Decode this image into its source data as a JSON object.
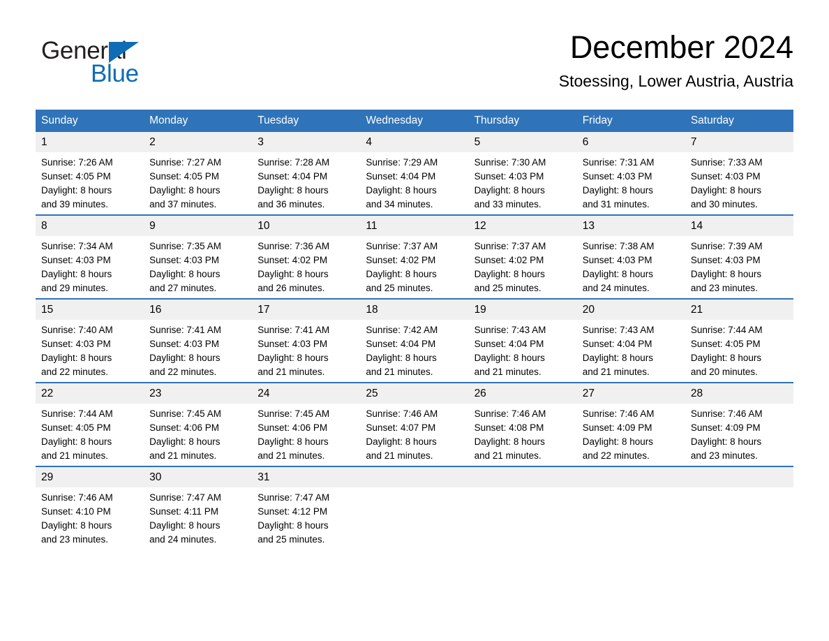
{
  "brand": {
    "name_part1": "General",
    "name_part2": "Blue",
    "triangle_color": "#0f6cb5"
  },
  "header": {
    "title": "December 2024",
    "location": "Stoessing, Lower Austria, Austria"
  },
  "theme": {
    "header_blue": "#2f73b8",
    "daynum_gray": "#f0f0f0",
    "text_black": "#000000"
  },
  "columns": [
    "Sunday",
    "Monday",
    "Tuesday",
    "Wednesday",
    "Thursday",
    "Friday",
    "Saturday"
  ],
  "weeks": [
    [
      {
        "day": "1",
        "sunrise": "Sunrise: 7:26 AM",
        "sunset": "Sunset: 4:05 PM",
        "daylight1": "Daylight: 8 hours",
        "daylight2": "and 39 minutes."
      },
      {
        "day": "2",
        "sunrise": "Sunrise: 7:27 AM",
        "sunset": "Sunset: 4:05 PM",
        "daylight1": "Daylight: 8 hours",
        "daylight2": "and 37 minutes."
      },
      {
        "day": "3",
        "sunrise": "Sunrise: 7:28 AM",
        "sunset": "Sunset: 4:04 PM",
        "daylight1": "Daylight: 8 hours",
        "daylight2": "and 36 minutes."
      },
      {
        "day": "4",
        "sunrise": "Sunrise: 7:29 AM",
        "sunset": "Sunset: 4:04 PM",
        "daylight1": "Daylight: 8 hours",
        "daylight2": "and 34 minutes."
      },
      {
        "day": "5",
        "sunrise": "Sunrise: 7:30 AM",
        "sunset": "Sunset: 4:03 PM",
        "daylight1": "Daylight: 8 hours",
        "daylight2": "and 33 minutes."
      },
      {
        "day": "6",
        "sunrise": "Sunrise: 7:31 AM",
        "sunset": "Sunset: 4:03 PM",
        "daylight1": "Daylight: 8 hours",
        "daylight2": "and 31 minutes."
      },
      {
        "day": "7",
        "sunrise": "Sunrise: 7:33 AM",
        "sunset": "Sunset: 4:03 PM",
        "daylight1": "Daylight: 8 hours",
        "daylight2": "and 30 minutes."
      }
    ],
    [
      {
        "day": "8",
        "sunrise": "Sunrise: 7:34 AM",
        "sunset": "Sunset: 4:03 PM",
        "daylight1": "Daylight: 8 hours",
        "daylight2": "and 29 minutes."
      },
      {
        "day": "9",
        "sunrise": "Sunrise: 7:35 AM",
        "sunset": "Sunset: 4:03 PM",
        "daylight1": "Daylight: 8 hours",
        "daylight2": "and 27 minutes."
      },
      {
        "day": "10",
        "sunrise": "Sunrise: 7:36 AM",
        "sunset": "Sunset: 4:02 PM",
        "daylight1": "Daylight: 8 hours",
        "daylight2": "and 26 minutes."
      },
      {
        "day": "11",
        "sunrise": "Sunrise: 7:37 AM",
        "sunset": "Sunset: 4:02 PM",
        "daylight1": "Daylight: 8 hours",
        "daylight2": "and 25 minutes."
      },
      {
        "day": "12",
        "sunrise": "Sunrise: 7:37 AM",
        "sunset": "Sunset: 4:02 PM",
        "daylight1": "Daylight: 8 hours",
        "daylight2": "and 25 minutes."
      },
      {
        "day": "13",
        "sunrise": "Sunrise: 7:38 AM",
        "sunset": "Sunset: 4:03 PM",
        "daylight1": "Daylight: 8 hours",
        "daylight2": "and 24 minutes."
      },
      {
        "day": "14",
        "sunrise": "Sunrise: 7:39 AM",
        "sunset": "Sunset: 4:03 PM",
        "daylight1": "Daylight: 8 hours",
        "daylight2": "and 23 minutes."
      }
    ],
    [
      {
        "day": "15",
        "sunrise": "Sunrise: 7:40 AM",
        "sunset": "Sunset: 4:03 PM",
        "daylight1": "Daylight: 8 hours",
        "daylight2": "and 22 minutes."
      },
      {
        "day": "16",
        "sunrise": "Sunrise: 7:41 AM",
        "sunset": "Sunset: 4:03 PM",
        "daylight1": "Daylight: 8 hours",
        "daylight2": "and 22 minutes."
      },
      {
        "day": "17",
        "sunrise": "Sunrise: 7:41 AM",
        "sunset": "Sunset: 4:03 PM",
        "daylight1": "Daylight: 8 hours",
        "daylight2": "and 21 minutes."
      },
      {
        "day": "18",
        "sunrise": "Sunrise: 7:42 AM",
        "sunset": "Sunset: 4:04 PM",
        "daylight1": "Daylight: 8 hours",
        "daylight2": "and 21 minutes."
      },
      {
        "day": "19",
        "sunrise": "Sunrise: 7:43 AM",
        "sunset": "Sunset: 4:04 PM",
        "daylight1": "Daylight: 8 hours",
        "daylight2": "and 21 minutes."
      },
      {
        "day": "20",
        "sunrise": "Sunrise: 7:43 AM",
        "sunset": "Sunset: 4:04 PM",
        "daylight1": "Daylight: 8 hours",
        "daylight2": "and 21 minutes."
      },
      {
        "day": "21",
        "sunrise": "Sunrise: 7:44 AM",
        "sunset": "Sunset: 4:05 PM",
        "daylight1": "Daylight: 8 hours",
        "daylight2": "and 20 minutes."
      }
    ],
    [
      {
        "day": "22",
        "sunrise": "Sunrise: 7:44 AM",
        "sunset": "Sunset: 4:05 PM",
        "daylight1": "Daylight: 8 hours",
        "daylight2": "and 21 minutes."
      },
      {
        "day": "23",
        "sunrise": "Sunrise: 7:45 AM",
        "sunset": "Sunset: 4:06 PM",
        "daylight1": "Daylight: 8 hours",
        "daylight2": "and 21 minutes."
      },
      {
        "day": "24",
        "sunrise": "Sunrise: 7:45 AM",
        "sunset": "Sunset: 4:06 PM",
        "daylight1": "Daylight: 8 hours",
        "daylight2": "and 21 minutes."
      },
      {
        "day": "25",
        "sunrise": "Sunrise: 7:46 AM",
        "sunset": "Sunset: 4:07 PM",
        "daylight1": "Daylight: 8 hours",
        "daylight2": "and 21 minutes."
      },
      {
        "day": "26",
        "sunrise": "Sunrise: 7:46 AM",
        "sunset": "Sunset: 4:08 PM",
        "daylight1": "Daylight: 8 hours",
        "daylight2": "and 21 minutes."
      },
      {
        "day": "27",
        "sunrise": "Sunrise: 7:46 AM",
        "sunset": "Sunset: 4:09 PM",
        "daylight1": "Daylight: 8 hours",
        "daylight2": "and 22 minutes."
      },
      {
        "day": "28",
        "sunrise": "Sunrise: 7:46 AM",
        "sunset": "Sunset: 4:09 PM",
        "daylight1": "Daylight: 8 hours",
        "daylight2": "and 23 minutes."
      }
    ],
    [
      {
        "day": "29",
        "sunrise": "Sunrise: 7:46 AM",
        "sunset": "Sunset: 4:10 PM",
        "daylight1": "Daylight: 8 hours",
        "daylight2": "and 23 minutes."
      },
      {
        "day": "30",
        "sunrise": "Sunrise: 7:47 AM",
        "sunset": "Sunset: 4:11 PM",
        "daylight1": "Daylight: 8 hours",
        "daylight2": "and 24 minutes."
      },
      {
        "day": "31",
        "sunrise": "Sunrise: 7:47 AM",
        "sunset": "Sunset: 4:12 PM",
        "daylight1": "Daylight: 8 hours",
        "daylight2": "and 25 minutes."
      },
      {
        "day": "",
        "sunrise": "",
        "sunset": "",
        "daylight1": "",
        "daylight2": ""
      },
      {
        "day": "",
        "sunrise": "",
        "sunset": "",
        "daylight1": "",
        "daylight2": ""
      },
      {
        "day": "",
        "sunrise": "",
        "sunset": "",
        "daylight1": "",
        "daylight2": ""
      },
      {
        "day": "",
        "sunrise": "",
        "sunset": "",
        "daylight1": "",
        "daylight2": ""
      }
    ]
  ]
}
